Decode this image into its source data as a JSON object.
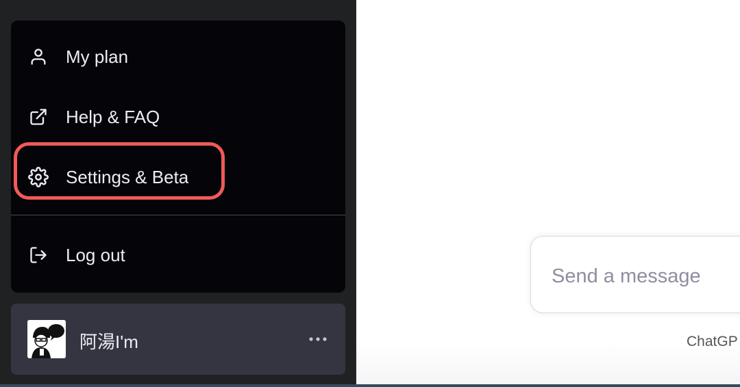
{
  "menu": {
    "items": [
      {
        "label": "My plan",
        "icon": "user-icon"
      },
      {
        "label": "Help & FAQ",
        "icon": "external-link-icon"
      },
      {
        "label": "Settings & Beta",
        "icon": "gear-icon"
      },
      {
        "label": "Log out",
        "icon": "logout-icon"
      }
    ]
  },
  "user": {
    "name": "阿湯I'm",
    "avatar_badge": "阿湯"
  },
  "composer": {
    "placeholder": "Send a message"
  },
  "footer": {
    "text": "ChatGP"
  },
  "colors": {
    "sidebar_bg": "#202123",
    "menu_bg": "#050509",
    "user_row_bg": "#343541",
    "highlight": "#f05a58",
    "menu_text": "#ececf1"
  }
}
